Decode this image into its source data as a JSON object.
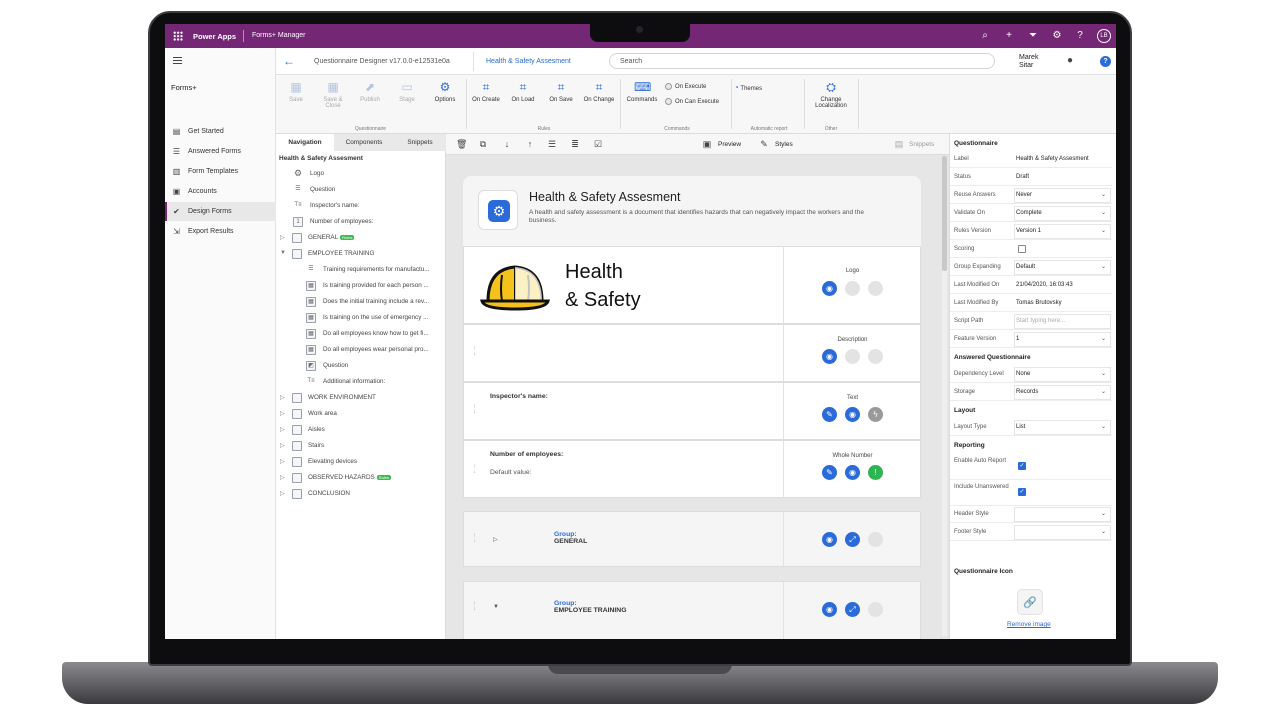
{
  "appbar": {
    "brand": "Power Apps",
    "crumb": "Forms+ Manager",
    "avatar": "LB",
    "icons": [
      "search-icon",
      "plus-icon",
      "filter-icon",
      "gear-icon",
      "help-icon"
    ]
  },
  "leftnav": {
    "section": "Forms+",
    "items": [
      {
        "label": "Get Started",
        "icon": "document-icon"
      },
      {
        "label": "Answered Forms",
        "icon": "list-icon"
      },
      {
        "label": "Form Templates",
        "icon": "template-icon"
      },
      {
        "label": "Accounts",
        "icon": "account-icon"
      },
      {
        "label": "Design Forms",
        "icon": "check-circle-icon"
      },
      {
        "label": "Export Results",
        "icon": "export-icon"
      }
    ]
  },
  "header": {
    "designer_title": "Questionnaire Designer v17.0.0-e12531e0a",
    "questionnaire_name": "Health & Safety Assesment",
    "search_placeholder": "Search",
    "user_first": "Marek",
    "user_last": "Sitar"
  },
  "ribbon": {
    "questionnaire_group": "Questionnaire",
    "rules_group": "Rules",
    "commands_group": "Commands",
    "report_group": "Automatic report",
    "other_group": "Other",
    "save": "Save",
    "save_close_1": "Save &",
    "save_close_2": "Close",
    "publish": "Publish",
    "stage": "Stage",
    "options": "Options",
    "on_create": "On Create",
    "on_load": "On Load",
    "on_save": "On Save",
    "on_change": "On Change",
    "commands": "Commands",
    "on_execute": "On Execute",
    "on_can_execute": "On Can Execute",
    "themes": "Themes",
    "change_loc_1": "Change",
    "change_loc_2": "Localization"
  },
  "navpane": {
    "tabs": [
      "Navigation",
      "Components",
      "Snippets"
    ],
    "root": "Health & Safety Assesment",
    "rules_badge": "Rules",
    "nodes": [
      {
        "label": "Logo"
      },
      {
        "label": "Question"
      },
      {
        "label": "Inspector's name:"
      },
      {
        "label": "Number of employees:"
      },
      {
        "label": "GENERAL"
      },
      {
        "label": "EMPLOYEE TRAINING"
      },
      {
        "label": "Training requirements for manufactu..."
      },
      {
        "label": "Is training provided for each person ..."
      },
      {
        "label": "Does the initial training include a rev..."
      },
      {
        "label": "Is training on the use of emergency ..."
      },
      {
        "label": "Do all employees know how to get fi..."
      },
      {
        "label": "Do all employees wear personal pro..."
      },
      {
        "label": "Question"
      },
      {
        "label": "Additional information:"
      },
      {
        "label": "WORK ENVIRONMENT"
      },
      {
        "label": "Work area"
      },
      {
        "label": "Aisles"
      },
      {
        "label": "Stairs"
      },
      {
        "label": "Elevating devices"
      },
      {
        "label": "OBSERVED HAZARDS"
      },
      {
        "label": "CONCLUSION"
      }
    ]
  },
  "canvas": {
    "preview": "Preview",
    "styles": "Styles",
    "snippets": "Snippets",
    "form_title": "Health & Safety Assesment",
    "form_desc": "A health and safety assessment is a document that identifies hazards that can negatively impact the workers and the business.",
    "logo_text_1": "Health",
    "logo_text_2": "& Safety",
    "logo_label": "Logo",
    "description_label": "Description",
    "text_label": "Text",
    "whole_number_label": "Whole Number",
    "inspector_label": "Inspector's name:",
    "employees_label": "Number of employees:",
    "default_value_label": "Default value:",
    "group_prefix": "Group:",
    "group_general": "GENERAL",
    "group_training": "EMPLOYEE TRAINING"
  },
  "props": {
    "section_questionnaire": "Questionnaire",
    "section_answered": "Answered Questionnaire",
    "section_layout": "Layout",
    "section_reporting": "Reporting",
    "section_icon": "Questionnaire Icon",
    "remove_image": "Remove image",
    "rows": [
      {
        "label": "Label",
        "value": "Health & Safety Assesment"
      },
      {
        "label": "Status",
        "value": "Draft"
      },
      {
        "label": "Reuse Answers",
        "value": "Never"
      },
      {
        "label": "Validate On",
        "value": "Complete"
      },
      {
        "label": "Rules Version",
        "value": "Version 1"
      },
      {
        "label": "Scoring",
        "value": ""
      },
      {
        "label": "Group Expanding",
        "value": "Default"
      },
      {
        "label": "Last Modified On",
        "value": "21/04/2020, 16:03:43"
      },
      {
        "label": "Last Modified By",
        "value": "Tomas Brutovsky"
      },
      {
        "label": "Script Path",
        "value": "Start typing here..."
      },
      {
        "label": "Feature Version",
        "value": "1"
      },
      {
        "label": "Dependency Level",
        "value": "None"
      },
      {
        "label": "Storage",
        "value": "Records"
      },
      {
        "label": "Layout Type",
        "value": "List"
      },
      {
        "label": "Enable Auto Report",
        "value": ""
      },
      {
        "label": "Include Unanswered",
        "value": ""
      },
      {
        "label": "Header Style",
        "value": ""
      },
      {
        "label": "Footer Style",
        "value": ""
      }
    ]
  },
  "colors": {
    "brand": "#742774",
    "accent": "#2a6ad9",
    "success": "#2cb552"
  }
}
